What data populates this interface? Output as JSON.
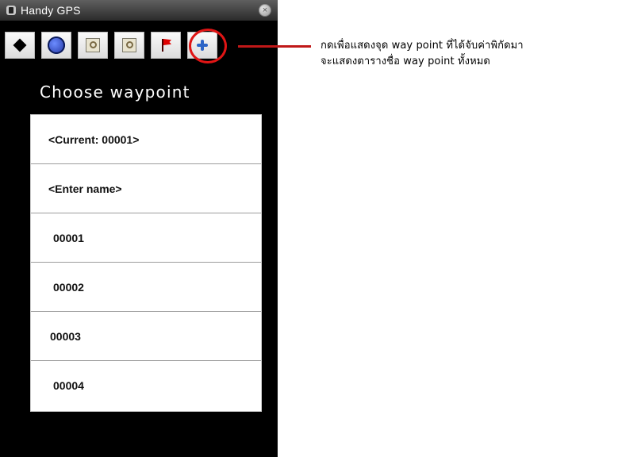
{
  "window": {
    "title": "Handy GPS",
    "close_glyph": "×"
  },
  "toolbar": {
    "buttons": [
      {
        "icon": "diamond-icon"
      },
      {
        "icon": "globe-icon"
      },
      {
        "icon": "map-icon"
      },
      {
        "icon": "map-icon"
      },
      {
        "icon": "flag-icon",
        "highlighted": true
      },
      {
        "icon": "plus-icon"
      }
    ]
  },
  "screen": {
    "heading": "Choose waypoint",
    "items": [
      {
        "label": "<Current: 00001>"
      },
      {
        "label": "<Enter name>"
      },
      {
        "label": "00001"
      },
      {
        "label": "00002"
      },
      {
        "label": "00003"
      },
      {
        "label": "00004"
      }
    ]
  },
  "annotation": {
    "line1": "กดเพื่อแสดงจุด way point ที่ได้จับค่าพิกัดมา",
    "line2": "จะแสดงตารางชื่อ way point ทั้งหมด"
  },
  "colors": {
    "accent": "#e01515",
    "background": "#000000",
    "list_bg": "#ffffff"
  }
}
